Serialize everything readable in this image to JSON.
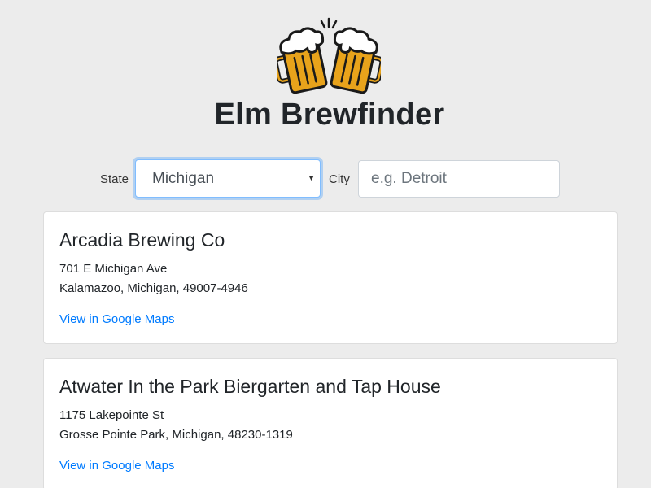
{
  "header": {
    "logo_icon": "cheers-beer-mugs-icon",
    "title": "Elm Brewfinder"
  },
  "filters": {
    "state_label": "State",
    "state_value": "Michigan",
    "city_label": "City",
    "city_placeholder": "e.g. Detroit",
    "city_value": ""
  },
  "breweries": [
    {
      "name": "Arcadia Brewing Co",
      "street": "701 E Michigan Ave",
      "locality": "Kalamazoo, Michigan, 49007-4946",
      "link_label": "View in Google Maps"
    },
    {
      "name": "Atwater In the Park Biergarten and Tap House",
      "street": "1175 Lakepointe St",
      "locality": "Grosse Pointe Park, Michigan, 48230-1319",
      "link_label": "View in Google Maps"
    }
  ],
  "colors": {
    "background": "#ececec",
    "link": "#007bff",
    "beer": "#e8a31b",
    "focus_border": "#80bdff"
  }
}
